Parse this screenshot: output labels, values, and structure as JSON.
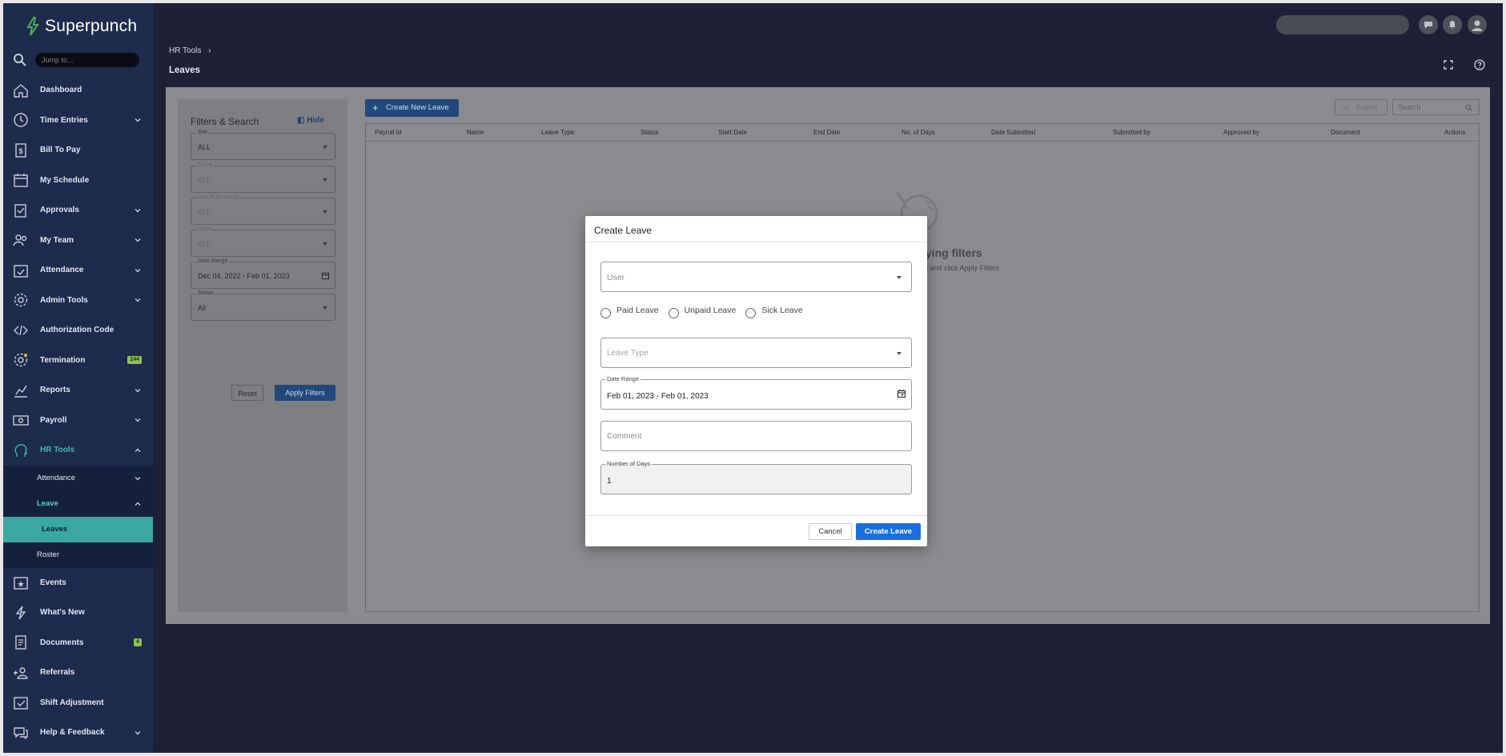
{
  "app": {
    "name": "Superpunch",
    "jump_placeholder": "Jump to..."
  },
  "sidebar": {
    "items": [
      {
        "label": "Dashboard",
        "icon": "home-icon"
      },
      {
        "label": "Time Entries",
        "icon": "clock-icon",
        "expandable": true
      },
      {
        "label": "Bill To Pay",
        "icon": "bill-icon"
      },
      {
        "label": "My Schedule",
        "icon": "calendar-icon"
      },
      {
        "label": "Approvals",
        "icon": "checklist-icon",
        "expandable": true
      },
      {
        "label": "My Team",
        "icon": "team-icon",
        "expandable": true
      },
      {
        "label": "Attendance",
        "icon": "calendar-check-icon",
        "expandable": true
      },
      {
        "label": "Admin Tools",
        "icon": "gear-icon",
        "expandable": true
      },
      {
        "label": "Authorization Code",
        "icon": "code-icon"
      },
      {
        "label": "Termination",
        "icon": "gear-alert-icon",
        "badge": "244"
      },
      {
        "label": "Reports",
        "icon": "chart-icon",
        "expandable": true
      },
      {
        "label": "Payroll",
        "icon": "money-icon",
        "expandable": true
      },
      {
        "label": "HR Tools",
        "icon": "head-icon",
        "expanded": true
      }
    ],
    "hr_sub": {
      "attendance": "Attendance",
      "leave": "Leave",
      "leaves": "Leaves",
      "roster": "Roster"
    },
    "bottom_items": [
      {
        "label": "Events",
        "icon": "events-icon"
      },
      {
        "label": "What's New",
        "icon": "bolt-icon"
      },
      {
        "label": "Documents",
        "icon": "documents-icon",
        "badge": "4"
      },
      {
        "label": "Referrals",
        "icon": "referral-icon"
      },
      {
        "label": "Shift Adjustment",
        "icon": "shift-icon"
      },
      {
        "label": "Help & Feedback",
        "icon": "help-chat-icon",
        "expandable": true
      }
    ]
  },
  "header": {
    "breadcrumb": "HR Tools",
    "title": "Leaves"
  },
  "filters": {
    "title": "Filters & Search",
    "hide": "Hide",
    "fields": [
      {
        "label": "Site",
        "value": "ALL"
      },
      {
        "label": "Client",
        "value": "ALL"
      },
      {
        "label": "Line of Business",
        "value": "ALL"
      },
      {
        "label": "User",
        "value": "ALL"
      },
      {
        "label": "Date Range",
        "value": "Dec 04, 2022 - Feb 01, 2023"
      },
      {
        "label": "Status",
        "value": "All"
      }
    ],
    "reset": "Reset",
    "apply": "Apply Filters"
  },
  "toolbar": {
    "create_new": "Create New Leave",
    "export": "Export",
    "search_placeholder": "Search"
  },
  "table": {
    "columns": [
      "Payroll Id",
      "Name",
      "Leave Type",
      "Status",
      "Start Date",
      "End Date",
      "No. of Days",
      "Date Submitted",
      "Submitted by",
      "Approved by",
      "Document",
      "Actions"
    ],
    "empty_title": "lying filters",
    "empty_sub": "el and click Apply Filters"
  },
  "modal": {
    "title": "Create Leave",
    "user_placeholder": "User",
    "radios": [
      "Paid Leave",
      "Unpaid Leave",
      "Sick Leave"
    ],
    "leave_type_placeholder": "Leave Type",
    "date_range_label": "Date Range",
    "date_range_value": "Feb 01, 2023 - Feb 01, 2023",
    "comment_placeholder": "Comment",
    "days_label": "Number of Days",
    "days_value": "1",
    "cancel": "Cancel",
    "create": "Create Leave"
  }
}
